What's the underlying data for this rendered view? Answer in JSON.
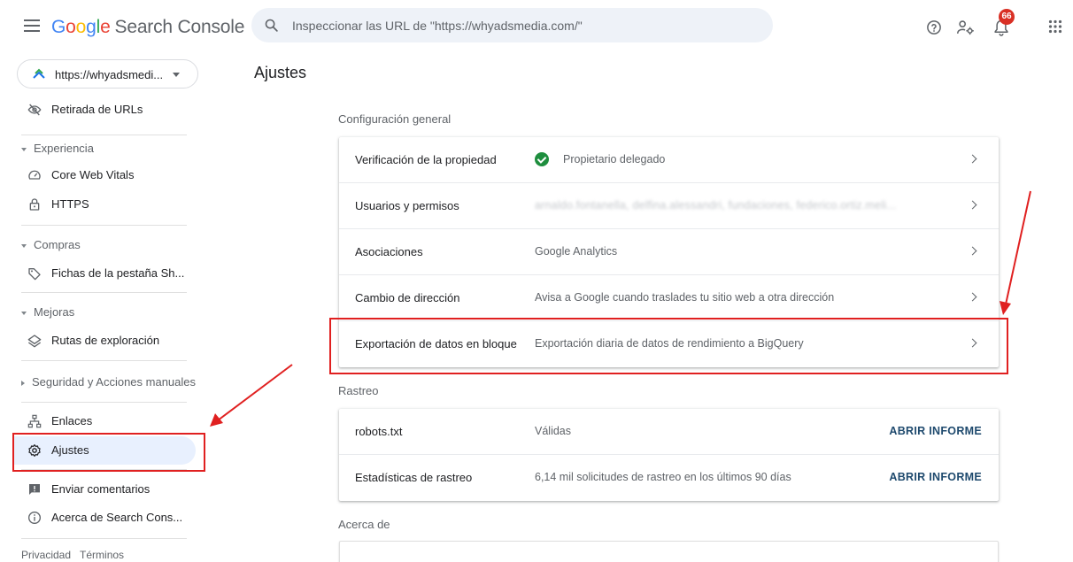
{
  "header": {
    "logo": {
      "g1": "G",
      "g2": "o",
      "g3": "o",
      "g4": "g",
      "g5": "l",
      "g6": "e",
      "product": "Search Console"
    },
    "search_placeholder": "Inspeccionar las URL de \"https://whyadsmedia.com/\"",
    "notification_count": "66",
    "icons": [
      "menu-icon",
      "search-icon",
      "help-icon",
      "manage-users-icon",
      "notifications-icon",
      "apps-icon"
    ]
  },
  "sidebar": {
    "property": "https://whyadsmedi...",
    "items": {
      "removals": "Retirada de URLs",
      "experience_header": "Experiencia",
      "cwv": "Core Web Vitals",
      "https": "HTTPS",
      "shopping_header": "Compras",
      "shopping_tab": "Fichas de la pestaña Sh...",
      "enhancements_header": "Mejoras",
      "breadcrumbs": "Rutas de exploración",
      "security_header": "Seguridad y Acciones manuales",
      "links": "Enlaces",
      "settings": "Ajustes",
      "feedback": "Enviar comentarios",
      "about": "Acerca de Search Cons..."
    },
    "footer": {
      "privacy": "Privacidad",
      "terms": "Términos"
    }
  },
  "main": {
    "title": "Ajustes",
    "general_section": "Configuración general",
    "general_rows": {
      "verification": {
        "label": "Verificación de la propiedad",
        "value": "Propietario delegado"
      },
      "users": {
        "label": "Usuarios y permisos",
        "value": "arnaldo.fontanella, delfina.alessandri, fundaciones, federico.ortiz.meli..."
      },
      "associations": {
        "label": "Asociaciones",
        "value": "Google Analytics"
      },
      "address_change": {
        "label": "Cambio de dirección",
        "value": "Avisa a Google cuando traslades tu sitio web a otra dirección"
      },
      "bulk_export": {
        "label": "Exportación de datos en bloque",
        "value": "Exportación diaria de datos de rendimiento a BigQuery"
      }
    },
    "crawl_section": "Rastreo",
    "crawl_rows": {
      "robots": {
        "label": "robots.txt",
        "value": "Válidas",
        "action": "ABRIR INFORME"
      },
      "crawl_stats": {
        "label": "Estadísticas de rastreo",
        "value": "6,14 mil solicitudes de rastreo en los últimos 90 días",
        "action": "ABRIR INFORME"
      }
    },
    "about_section": "Acerca de"
  },
  "colors": {
    "accent": "#1a73e8",
    "active_bg": "#e8f0fe",
    "annotation": "#e02020",
    "success": "#1e8e3e",
    "badge": "#d93025"
  }
}
